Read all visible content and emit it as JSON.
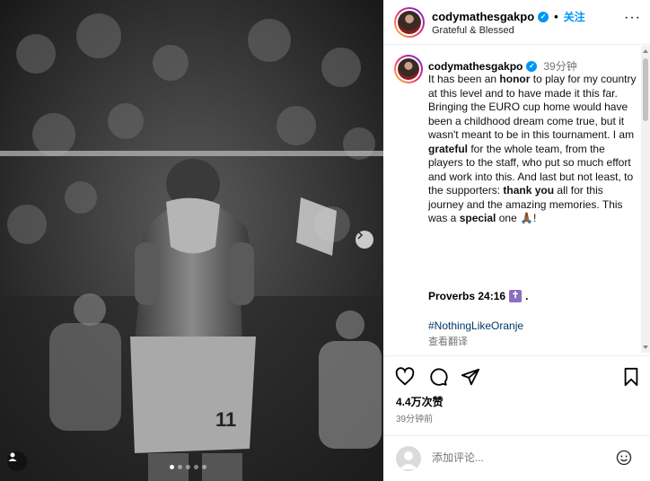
{
  "photo": {
    "jersey_number": "11",
    "carousel_dots": 5,
    "active_dot": 0,
    "next_icon": "chevron-right-icon",
    "tag_icon": "user-tag-icon"
  },
  "header": {
    "username": "codymathesgakpo",
    "separator": "•",
    "follow_label": "关注",
    "subtitle": "Grateful & Blessed",
    "more_icon": "ellipsis-icon"
  },
  "caption": {
    "username": "codymathesgakpo",
    "time": "39分钟",
    "text_parts": [
      {
        "t": "It has been an ",
        "b": false
      },
      {
        "t": "honor",
        "b": true
      },
      {
        "t": " to play for my country at this level and to have made it this far. Bringing the EURO cup home would have been a childhood dream come true, but it wasn't meant to be in this tournament. I am ",
        "b": false
      },
      {
        "t": "grateful",
        "b": true
      },
      {
        "t": " for the whole team, from the players to the staff, who put so much effort and work into this. And last but not least, to the supporters: ",
        "b": false
      },
      {
        "t": "thank you",
        "b": true
      },
      {
        "t": " all for this journey and the amazing memories. This was a ",
        "b": false
      },
      {
        "t": "special",
        "b": true
      },
      {
        "t": " one 🙏🏾!",
        "b": false
      }
    ],
    "proverbs": "Proverbs 24:16",
    "proverbs_emoji": "✝",
    "proverbs_end": ".",
    "hashtag": "#NothingLikeOranje",
    "see_translation": "查看翻译"
  },
  "actions": {
    "like_icon": "heart-icon",
    "comment_icon": "comment-icon",
    "share_icon": "send-icon",
    "save_icon": "bookmark-icon",
    "likes": "4.4万次赞",
    "posted_ago": "39分钟前"
  },
  "comment": {
    "placeholder": "添加评论...",
    "emoji_icon": "smiley-icon"
  },
  "colors": {
    "accent": "#0095f6",
    "link": "#00376b",
    "muted": "#737373",
    "border": "#efefef"
  }
}
